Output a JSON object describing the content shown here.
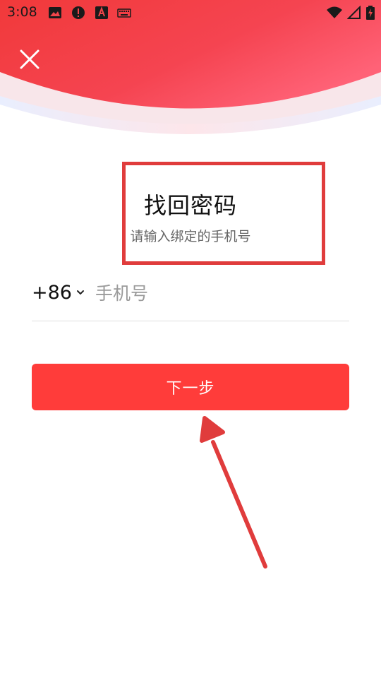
{
  "status_bar": {
    "time": "3:08",
    "left_icons": [
      "image-icon",
      "alert-icon",
      "app-a-icon",
      "keyboard-icon"
    ],
    "right_icons": [
      "wifi-icon",
      "signal-icon",
      "battery-charging-icon"
    ]
  },
  "header": {
    "close_icon": "close-icon",
    "gradient": [
      "#f5393b",
      "#ff6a7a"
    ]
  },
  "main": {
    "title": "找回密码",
    "subtitle": "请输入绑定的手机号",
    "country_code": "+86",
    "phone_placeholder": "手机号",
    "phone_value": "",
    "next_button_label": "下一步"
  },
  "colors": {
    "accent": "#ff3c3a",
    "annotation": "#e03c3c"
  }
}
